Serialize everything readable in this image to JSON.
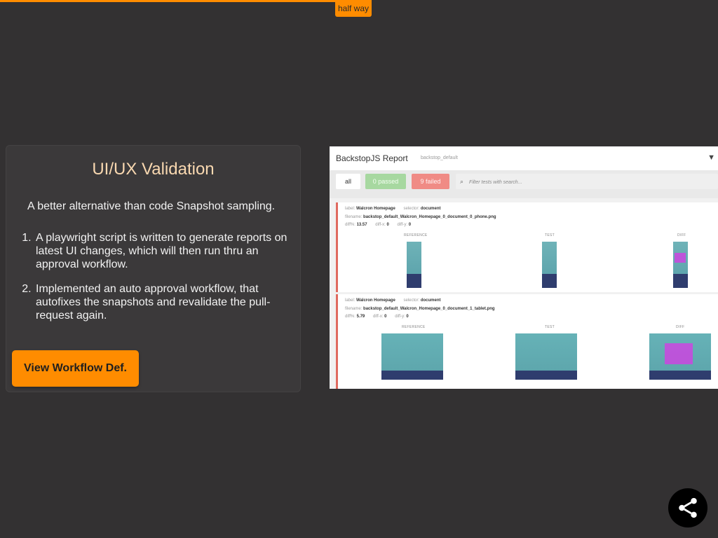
{
  "progress": {
    "label": "half way",
    "fraction": 0.5,
    "color": "#ff8c00"
  },
  "card": {
    "title": "UI/UX Validation",
    "subtitle": "A better alternative than code Snapshot sampling.",
    "items": [
      "A playwright script is written to generate reports on latest UI changes, which will then run thru an approval workflow.",
      "Implemented an auto approval workflow, that autofixes the snapshots and revalidate the pull-request again."
    ],
    "button_label": "View Workflow Def."
  },
  "report": {
    "title": "BackstopJS Report",
    "config": "backstop_default",
    "filters": {
      "all": "all",
      "passed": "0 passed",
      "failed": "9 failed",
      "search_placeholder": "Filter tests with search..."
    },
    "tests": [
      {
        "label_key": "label:",
        "label": "Walcron Homepage",
        "selector_key": "selector:",
        "selector": "document",
        "filename_key": "filename:",
        "filename": "backstop_default_Walcron_Homepage_0_document_0_phone.png",
        "diff_key": "diff%:",
        "diff": "13.57",
        "diffx_key": "diff-x:",
        "diffx": "0",
        "diffy_key": "diff-y:",
        "diffy": "0",
        "columns": [
          "REFERENCE",
          "TEST",
          "DIFF"
        ]
      },
      {
        "label_key": "label:",
        "label": "Walcron Homepage",
        "selector_key": "selector:",
        "selector": "document",
        "filename_key": "filename:",
        "filename": "backstop_default_Walcron_Homepage_0_document_1_tablet.png",
        "diff_key": "diff%:",
        "diff": "5.79",
        "diffx_key": "diff-x:",
        "diffx": "0",
        "diffy_key": "diff-y:",
        "diffy": "0",
        "columns": [
          "REFERENCE",
          "TEST",
          "DIFF"
        ]
      }
    ]
  },
  "share": {
    "icon": "share-icon"
  }
}
